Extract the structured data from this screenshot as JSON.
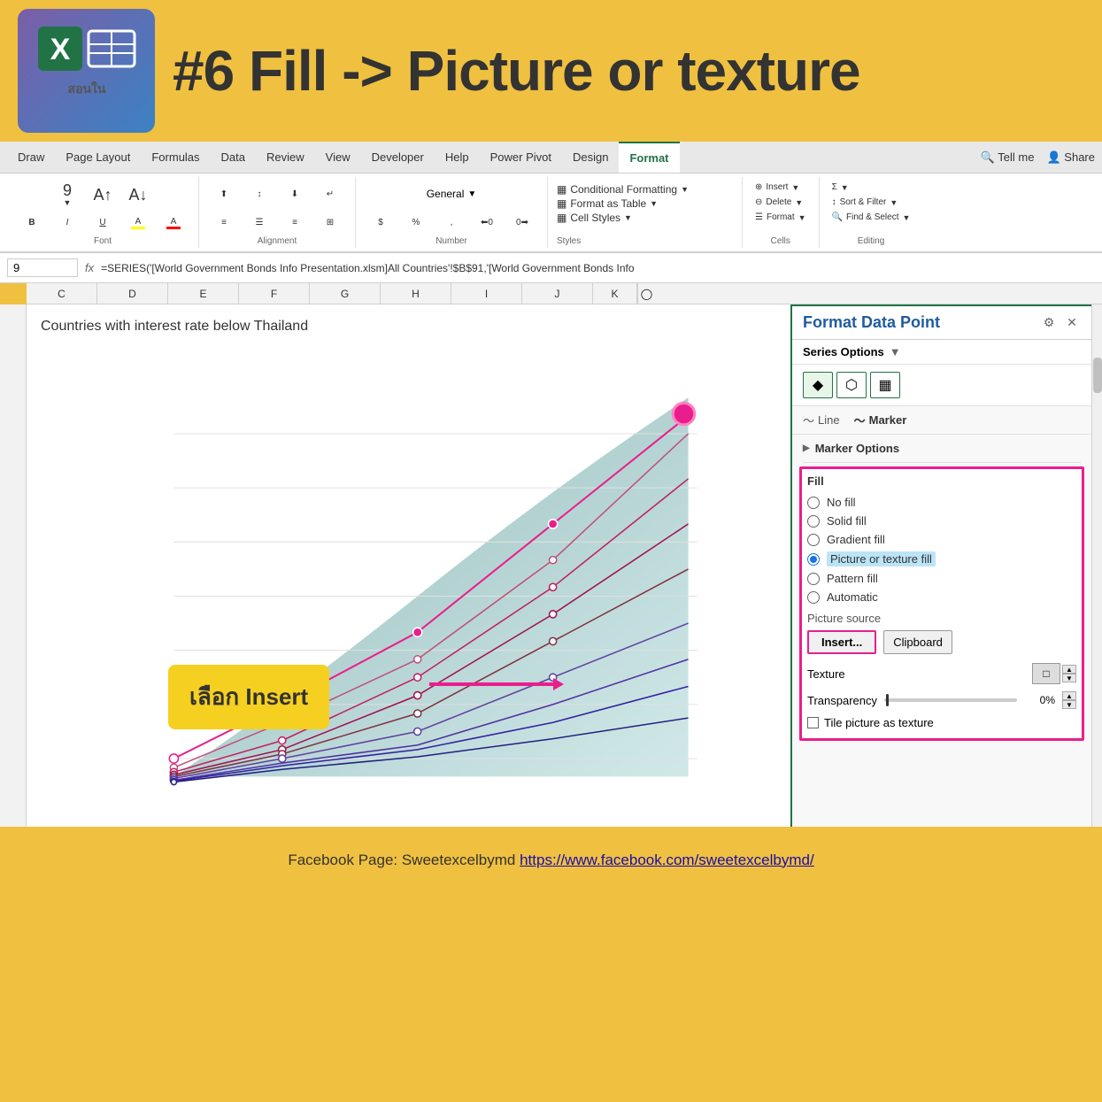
{
  "header": {
    "title_prefix": "#6 Fill -> Picture or texture",
    "logo_text": "Excel",
    "logo_subtitle": "สอนใน"
  },
  "ribbon": {
    "tabs": [
      "Draw",
      "Page Layout",
      "Formulas",
      "Data",
      "Review",
      "View",
      "Developer",
      "Help",
      "Power Pivot",
      "Design",
      "Format",
      "Tell me",
      "Share"
    ],
    "active_tab": "Format",
    "groups": {
      "font_label": "Font",
      "alignment_label": "Alignment",
      "number_label": "Number",
      "styles_label": "Styles",
      "cells_label": "Cells",
      "editing_label": "Editing"
    },
    "styles_links": [
      "Conditional Formatting",
      "Format as Table",
      "Cell Styles"
    ],
    "cells_links": [
      "Insert",
      "Delete",
      "Format"
    ],
    "editing_links": [
      "Sort & Filter",
      "Find & Select"
    ]
  },
  "formula_bar": {
    "name": "9",
    "fx": "fx",
    "formula": "=SERIES('[World Government Bonds Info Presentation.xlsm]All Countries'!$B$91,'[World Government Bonds Info"
  },
  "col_headers": [
    "C",
    "D",
    "E",
    "F",
    "G",
    "H",
    "I",
    "J",
    "K"
  ],
  "chart": {
    "title": "Countries with interest rate below Thailand"
  },
  "format_panel": {
    "title": "Format Data Point",
    "series_options_label": "Series Options",
    "icons": [
      "◆",
      "⬡",
      "▦"
    ],
    "line_label": "Line",
    "marker_label": "Marker",
    "marker_options_label": "Marker Options",
    "fill_section": {
      "title": "Fill",
      "options": [
        {
          "id": "no_fill",
          "label": "No fill",
          "checked": false
        },
        {
          "id": "solid_fill",
          "label": "Solid fill",
          "checked": false
        },
        {
          "id": "gradient_fill",
          "label": "Gradient fill",
          "checked": false
        },
        {
          "id": "picture_fill",
          "label": "Picture or texture fill",
          "checked": true
        },
        {
          "id": "pattern_fill",
          "label": "Pattern fill",
          "checked": false
        },
        {
          "id": "automatic",
          "label": "Automatic",
          "checked": false
        }
      ],
      "picture_source_label": "Picture source",
      "insert_btn": "Insert...",
      "clipboard_btn": "Clipboard",
      "texture_label": "Texture",
      "transparency_label": "Transparency",
      "transparency_value": "0%",
      "tile_label": "Tile picture as texture"
    }
  },
  "callout": {
    "text": "เลือก Insert"
  },
  "footer": {
    "text_prefix": "Facebook Page: Sweetexcelbymd",
    "link_text": "https://www.facebook.com/sweetexcelbymd/",
    "link_url": "https://www.facebook.com/sweetexcelbymd/"
  }
}
